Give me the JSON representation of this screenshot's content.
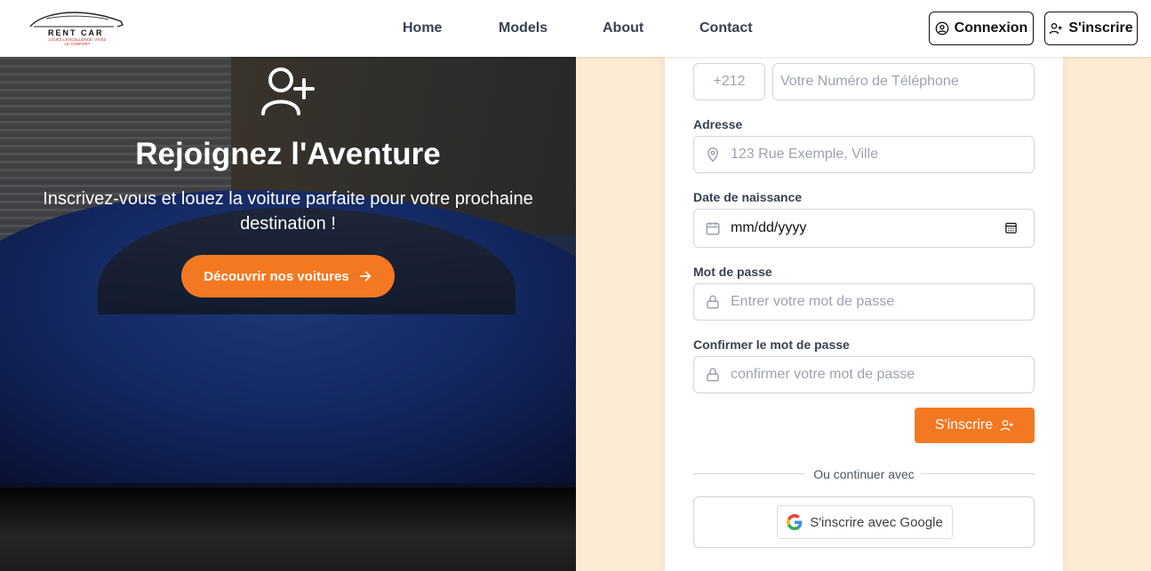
{
  "header": {
    "logo": {
      "brand": "RENT CAR",
      "tagline": "LOUEZ L'EXCELLENCE, VIVEZ LE CONFORT"
    },
    "nav": [
      "Home",
      "Models",
      "About",
      "Contact"
    ],
    "login_label": "Connexion",
    "signup_label": "S'inscrire"
  },
  "hero": {
    "title": "Rejoignez l'Aventure",
    "subtitle": "Inscrivez-vous et louez la voiture parfaite pour votre prochaine destination !",
    "cta_label": "Découvrir nos voitures"
  },
  "form": {
    "phone": {
      "prefix": "+212",
      "placeholder": "Votre Numéro de Téléphone"
    },
    "address": {
      "label": "Adresse",
      "placeholder": "123 Rue Exemple, Ville"
    },
    "birthdate": {
      "label": "Date de naissance",
      "value": "mm/dd/yyyy"
    },
    "password": {
      "label": "Mot de passe",
      "placeholder": "Entrer votre mot de passe"
    },
    "confirm_password": {
      "label": "Confirmer le mot de passe",
      "placeholder": "confirmer votre mot de passe"
    },
    "submit_label": "S'inscrire",
    "divider_text": "Ou continuer avec",
    "google_label": "S'inscrire avec Google"
  },
  "colors": {
    "accent": "#f47821",
    "panel_bg": "#fdebd3"
  }
}
